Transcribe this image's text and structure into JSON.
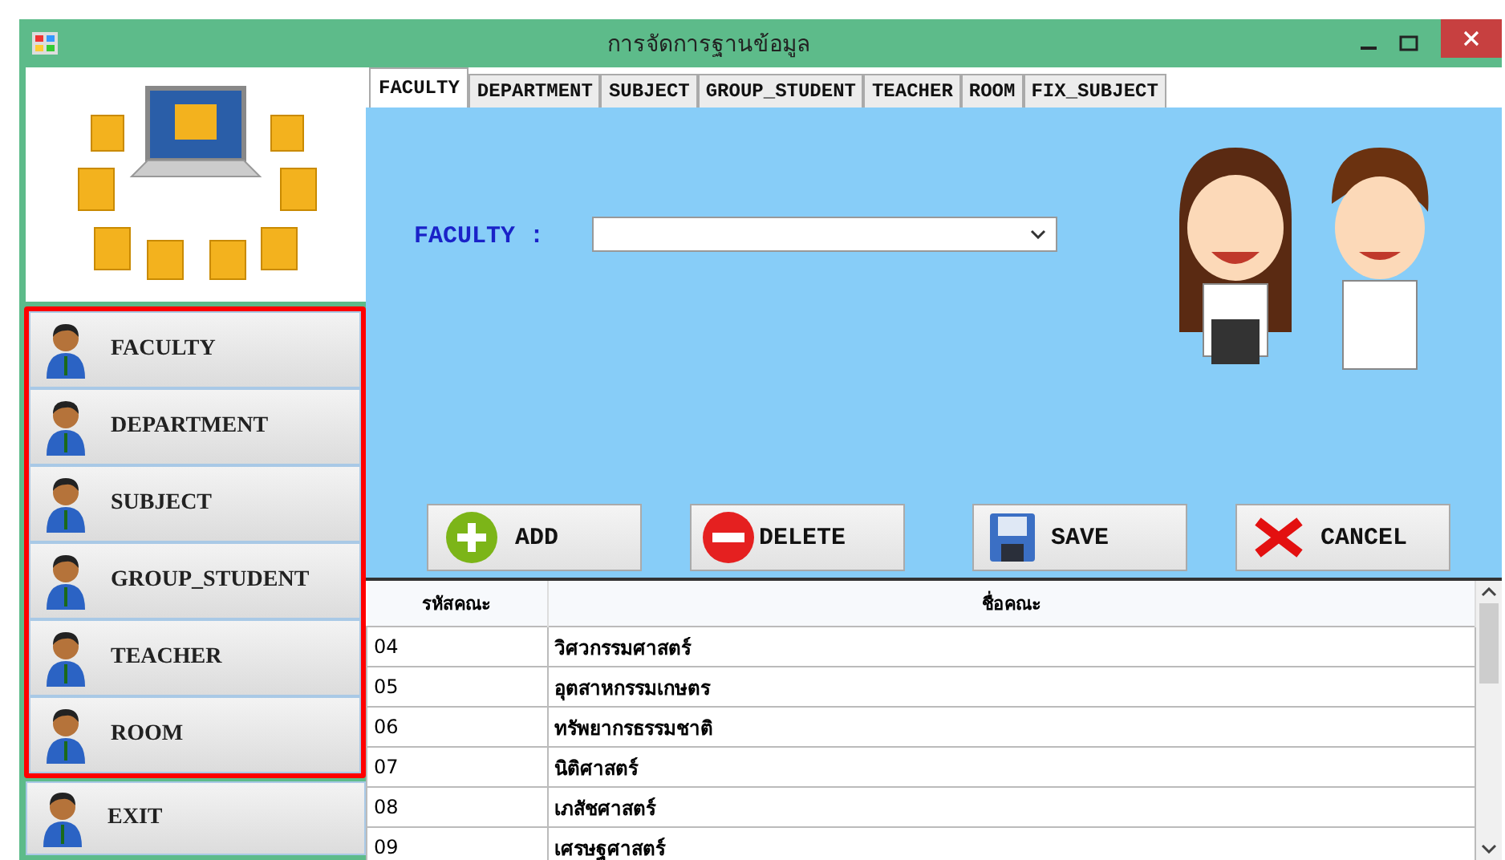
{
  "window": {
    "title": "การจัดการฐานข้อมูล"
  },
  "sidebar": {
    "items": [
      {
        "label": "FACULTY",
        "highlighted": true
      },
      {
        "label": "DEPARTMENT",
        "highlighted": true
      },
      {
        "label": "SUBJECT",
        "highlighted": true
      },
      {
        "label": "GROUP_STUDENT",
        "highlighted": true
      },
      {
        "label": "TEACHER",
        "highlighted": true
      },
      {
        "label": "ROOM",
        "highlighted": true
      },
      {
        "label": "EXIT",
        "highlighted": false
      }
    ]
  },
  "tabs": [
    {
      "label": "FACULTY",
      "selected": true
    },
    {
      "label": "DEPARTMENT",
      "selected": false
    },
    {
      "label": "SUBJECT",
      "selected": false
    },
    {
      "label": "GROUP_STUDENT",
      "selected": false
    },
    {
      "label": "TEACHER",
      "selected": false
    },
    {
      "label": "ROOM",
      "selected": false
    },
    {
      "label": "FIX_SUBJECT",
      "selected": false
    }
  ],
  "form": {
    "label": "FACULTY :"
  },
  "actions": [
    {
      "label": "ADD",
      "kind": "add"
    },
    {
      "label": "DELETE",
      "kind": "delete"
    },
    {
      "label": "SAVE",
      "kind": "save"
    },
    {
      "label": "CANCEL",
      "kind": "cancel"
    }
  ],
  "table": {
    "columns": [
      "รหัสคณะ",
      "ชื่อคณะ"
    ],
    "rows": [
      [
        "04",
        "วิศวกรรมศาสตร์"
      ],
      [
        "05",
        "อุตสาหกรรมเกษตร"
      ],
      [
        "06",
        "ทรัพยากรธรรมชาติ"
      ],
      [
        "07",
        "นิติศาสตร์"
      ],
      [
        "08",
        "เภสัชศาสตร์"
      ],
      [
        "09",
        "เศรษฐศาสตร์"
      ]
    ]
  }
}
